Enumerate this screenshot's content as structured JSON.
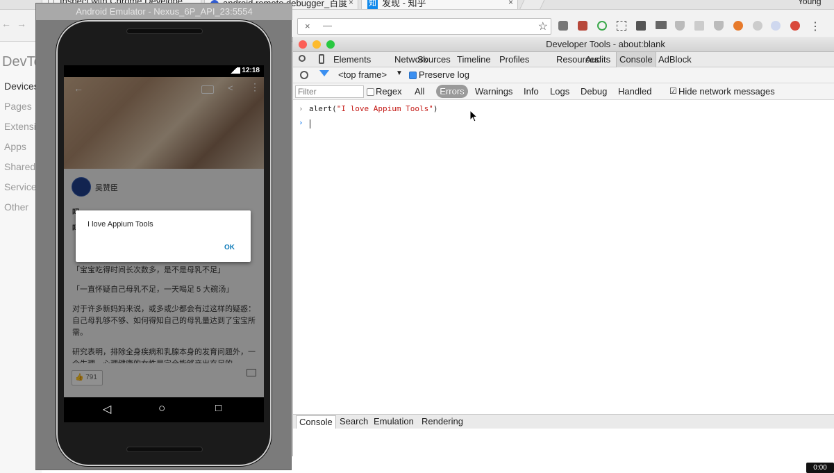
{
  "browser": {
    "tabs": [
      "Inspect with Chrome Develope",
      "android remote debugger_百度",
      "发现 - 知乎"
    ],
    "user": "Young",
    "tab_close_glyph": "×",
    "star_glyph": "☆",
    "menu_glyph": "⋮",
    "minimize_glyph": "—",
    "zhihu_badge": "知",
    "tab_icons": {
      "inspect": "document-icon",
      "baidu": "globe-icon",
      "zhihu": "zhihu-icon"
    },
    "extension_icons": [
      "extension-icon",
      "extension-icon",
      "extension-icon",
      "extension-icon",
      "extension-icon",
      "extension-icon",
      "extension-icon",
      "extension-icon",
      "extension-icon",
      "extension-icon",
      "extension-icon",
      "extension-icon",
      "extension-icon"
    ],
    "popup_close": "×",
    "popup_min": "—"
  },
  "devpage": {
    "title": "DevTo",
    "nav": [
      "Devices",
      "Pages",
      "Extensio",
      "Apps",
      "Shared",
      "Service",
      "Other"
    ]
  },
  "emulator": {
    "title": "Android Emulator - Nexus_6P_API_23:5554",
    "status_time": "12:18",
    "author": "吴赞臣",
    "paragraph_1": "「宝宝吃得时间长次数多，是不是母乳不足」",
    "paragraph_2": "「一直怀疑自己母乳不足，一天喝足 5 大碗汤」",
    "paragraph_3": "对于许多新妈妈来说，或多或少都会有过这样的疑惑：自己母乳够不够、如何得知自己的母乳量达到了宝宝所需。",
    "paragraph_4": "研究表明，排除全身疾病和乳腺本身的发育问题外，一个生理、心理健康的女性是完全能够产出充足的",
    "partial_line_1": "吗",
    "partial_line_2": "吗",
    "like_count": "791",
    "alert": {
      "message": "I love Appium Tools",
      "ok_label": "OK"
    },
    "nav_back": "◁",
    "nav_home": "○",
    "nav_recent": "□"
  },
  "devtools": {
    "title": "Developer Tools - about:blank",
    "tabs": [
      "Elements",
      "Network",
      "Sources",
      "Timeline",
      "Profiles",
      "Resources",
      "Audits",
      "Console",
      "AdBlock"
    ],
    "active_tab": "Console",
    "frame_selector": "<top frame>",
    "preserve_log": {
      "label": "Preserve log",
      "checked": true
    },
    "filter_placeholder": "Filter",
    "regex": {
      "label": "Regex",
      "checked": false
    },
    "levels": [
      "All",
      "Errors",
      "Warnings",
      "Info",
      "Logs",
      "Debug",
      "Handled"
    ],
    "active_level": "Errors",
    "hide_network": {
      "label": "Hide network messages",
      "checked": true
    },
    "console_lines": [
      {
        "fn": "alert(",
        "arg": "\"I love Appium Tools\"",
        "close": ")"
      }
    ],
    "drawer_tabs": [
      "Console",
      "Search",
      "Emulation",
      "Rendering"
    ],
    "active_drawer_tab": "Console"
  },
  "colors": {
    "devtools_accent": "#3b8ff0",
    "string_red": "#c41a16",
    "errors_pill": "#9a9a9a"
  },
  "recorder": {
    "label": "0:00"
  }
}
